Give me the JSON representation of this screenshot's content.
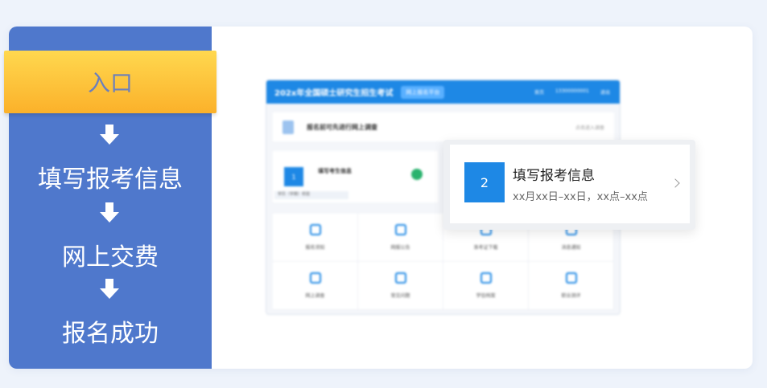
{
  "steps": {
    "entry": "入口",
    "items": [
      "填写报考信息",
      "网上交费",
      "报名成功"
    ]
  },
  "preview": {
    "header_title": "202x年全国硕士研究生招生考试",
    "header_badge": "网上报名平台",
    "nav": [
      "首页",
      "13300000001",
      "退出"
    ],
    "banner_text": "报名前可先进行网上调查",
    "banner_right": "点击进入调查",
    "row_num": "1",
    "row_title": "填写考生信息",
    "row_tag": "学历（学籍）校验",
    "grid": [
      "报名须知",
      "网报公告",
      "准考证下载",
      "消息通知",
      "网上调查",
      "常见问题",
      "学信档案",
      "职业测评"
    ]
  },
  "popup": {
    "num": "2",
    "title": "填写报考信息",
    "subtitle": "xx月xx日–xx日，xx点–xx点"
  },
  "colors": {
    "panel": "#4f78cc",
    "entry_top": "#ffd84f",
    "entry_bottom": "#fbb12a",
    "accent": "#1e88e5"
  }
}
